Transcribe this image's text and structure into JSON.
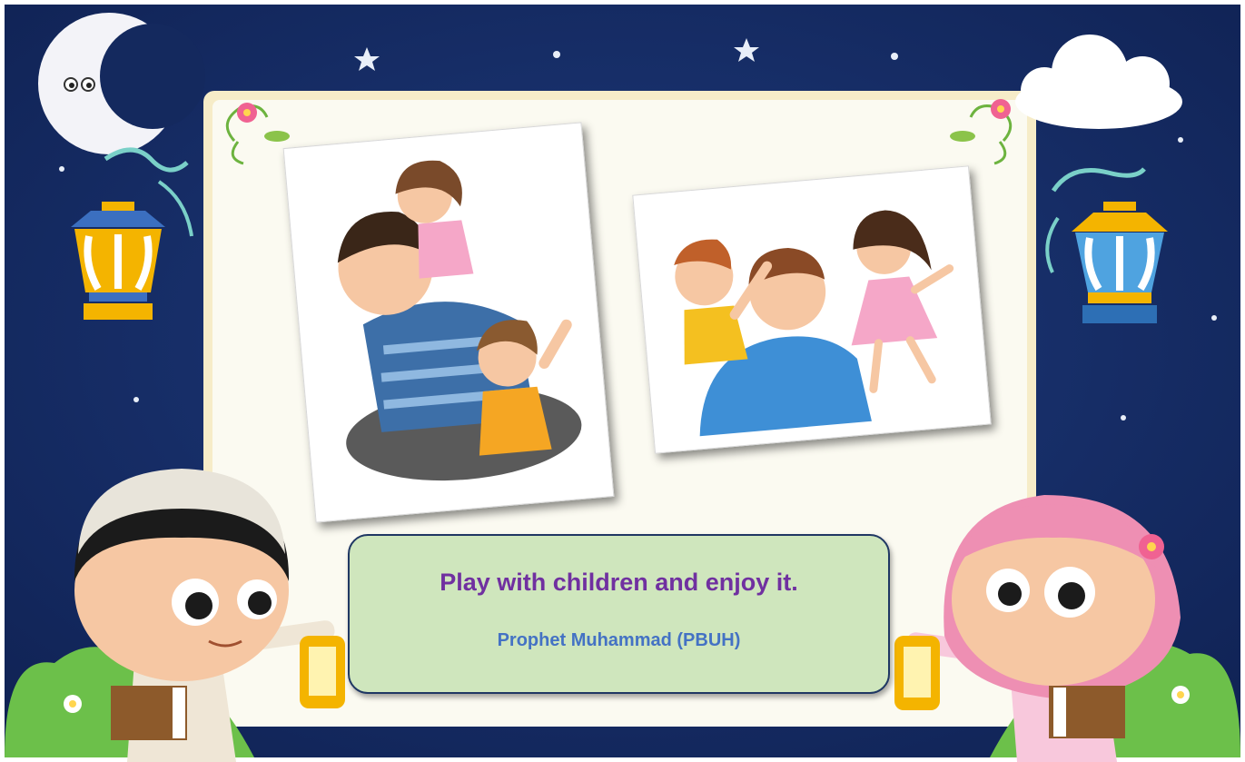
{
  "slide": {
    "quote": "Play with children and enjoy it.",
    "attribution": "Prophet Muhammad (PBUH)"
  },
  "colors": {
    "night_sky": "#14295e",
    "board": "#fbfaf1",
    "quote_box_fill": "#cfe6bd",
    "quote_box_border": "#1f3763",
    "quote_text": "#7030a0",
    "attribution_text": "#4472c4"
  },
  "decorations": [
    "crescent-moon-icon",
    "star-icon",
    "cloud-icon",
    "lantern-icon",
    "flower-vine-icon",
    "boy-in-kufi-illustration",
    "girl-in-hijab-illustration",
    "grass-hill-icon"
  ],
  "images": [
    {
      "name": "father-with-two-children-photo"
    },
    {
      "name": "father-with-boy-and-girl-photo"
    }
  ]
}
